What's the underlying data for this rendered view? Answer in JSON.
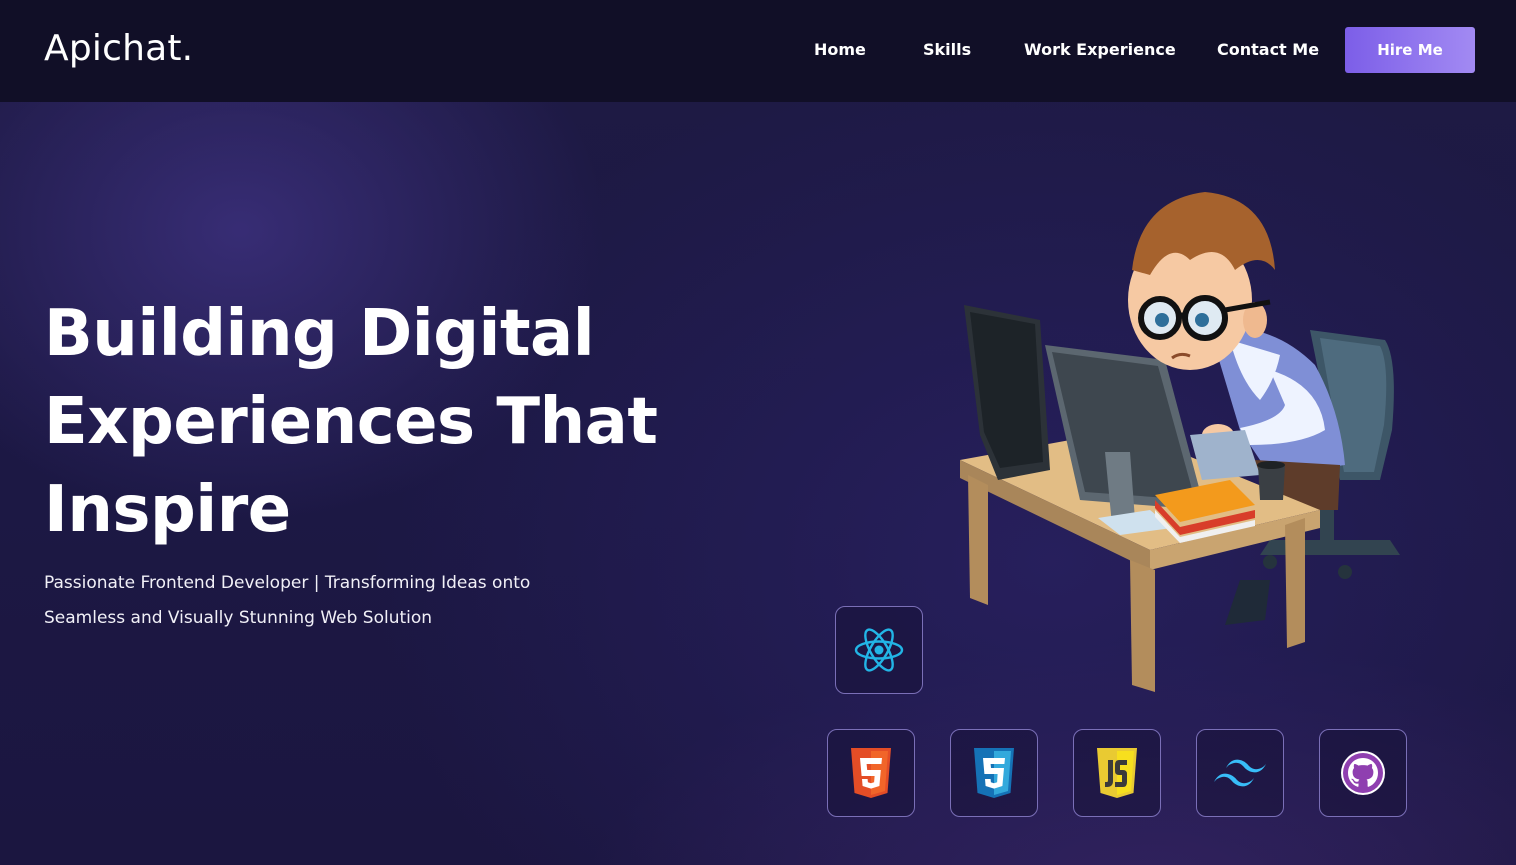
{
  "header": {
    "logo": "Apichat.",
    "nav": [
      "Home",
      "Skills",
      "Work Experience",
      "Contact Me"
    ],
    "cta": "Hire Me"
  },
  "hero": {
    "title": "Building Digital Experiences That Inspire",
    "subtitle_line1": "Passionate Frontend Developer | Transforming Ideas onto",
    "subtitle_line2": "Seamless and Visually Stunning Web Solution"
  },
  "skills": [
    "react-icon",
    "html5-icon",
    "css3-icon",
    "javascript-icon",
    "tailwind-icon",
    "github-icon"
  ],
  "colors": {
    "accent": "#8b6ff0",
    "background": "#1b1740",
    "header": "#110f27",
    "tile_border": "#7a6fb7"
  }
}
